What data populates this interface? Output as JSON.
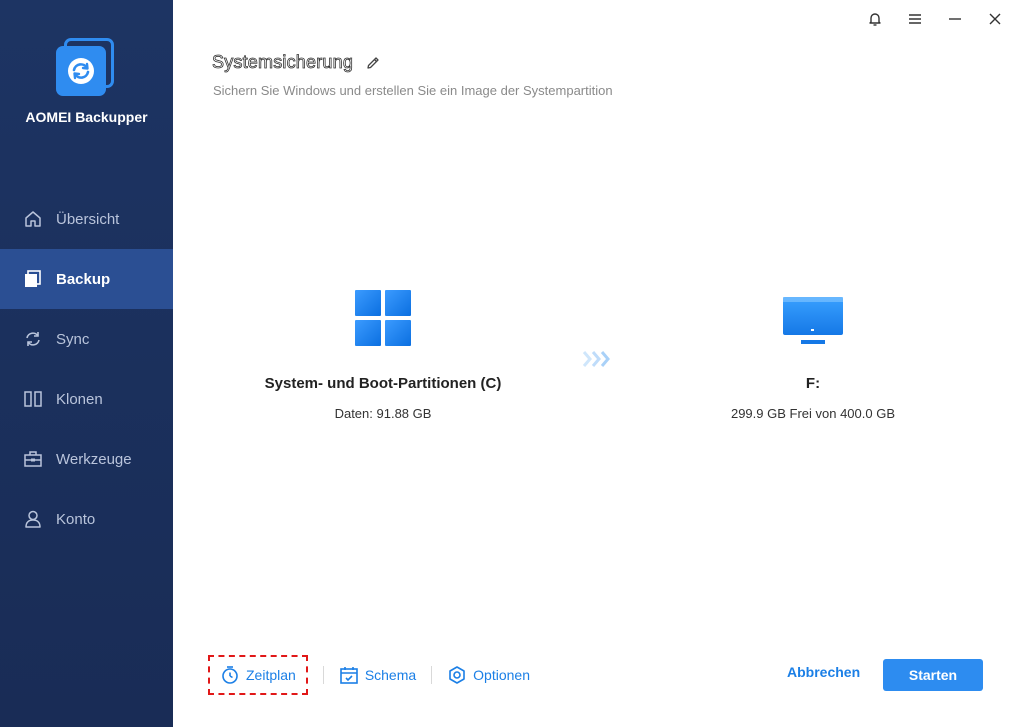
{
  "app": {
    "name": "AOMEI Backupper",
    "accent": "#2d8cf0",
    "sidebar_color": "#1d3463"
  },
  "nav": {
    "items": [
      {
        "label": "Übersicht",
        "icon": "home-icon",
        "active": false
      },
      {
        "label": "Backup",
        "icon": "backup-icon",
        "active": true
      },
      {
        "label": "Sync",
        "icon": "sync-icon",
        "active": false
      },
      {
        "label": "Klonen",
        "icon": "clone-icon",
        "active": false
      },
      {
        "label": "Werkzeuge",
        "icon": "toolbox-icon",
        "active": false
      },
      {
        "label": "Konto",
        "icon": "user-icon",
        "active": false
      }
    ]
  },
  "header": {
    "title": "Systemsicherung",
    "subtitle": "Sichern Sie Windows und erstellen Sie ein Image der Systempartition"
  },
  "source": {
    "title": "System- und Boot-Partitionen (C)",
    "info": "Daten: 91.88 GB",
    "icon": "windows-icon"
  },
  "destination": {
    "title": "F:",
    "info": "299.9 GB Frei von 400.0 GB",
    "icon": "monitor-icon"
  },
  "toolbar": {
    "zeitplan": "Zeitplan",
    "schema": "Schema",
    "optionen": "Optionen",
    "cancel": "Abbrechen",
    "start": "Starten"
  }
}
